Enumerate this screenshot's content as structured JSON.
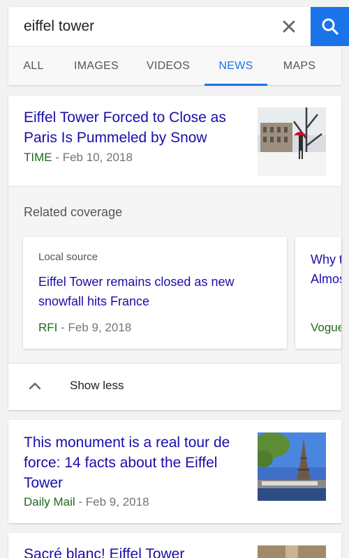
{
  "search": {
    "query": "eiffel tower"
  },
  "tabs": [
    {
      "label": "ALL"
    },
    {
      "label": "IMAGES"
    },
    {
      "label": "VIDEOS"
    },
    {
      "label": "NEWS"
    },
    {
      "label": "MAPS"
    }
  ],
  "active_tab": "NEWS",
  "colors": {
    "accent": "#1a73e8",
    "headline": "#1a0dab",
    "source": "#1e6b1e",
    "meta": "#70757a"
  },
  "articles": [
    {
      "headline_lines": [
        "Eiffel Tower Forced to Close as",
        "Paris Is Pummeled by Snow"
      ],
      "source": "TIME",
      "date": " - Feb 10, 2018"
    },
    {
      "headline_lines": [
        "This monument is a real tour de",
        "force: 14 facts about the Eiffel",
        "Tower"
      ],
      "source": "Daily Mail",
      "date": " - Feb 9, 2018"
    },
    {
      "headline_lines": [
        "Sacré blanc! Eiffel Tower"
      ]
    }
  ],
  "related": {
    "title": "Related coverage",
    "cards": [
      {
        "label": "Local source",
        "headline_lines": [
          "Eiffel Tower remains closed as new",
          "snowfall hits France"
        ],
        "source": "RFI",
        "date": " - Feb 9, 2018"
      },
      {
        "headline_lines": [
          "Why th",
          "Almos"
        ],
        "source": "Vogue"
      }
    ],
    "show_less_label": "Show less"
  }
}
